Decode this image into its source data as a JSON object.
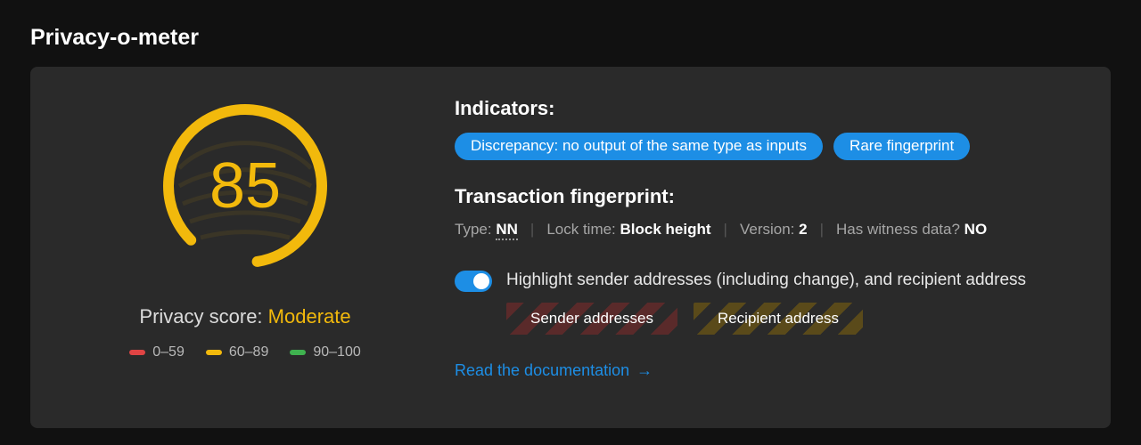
{
  "header": {
    "title": "Privacy-o-meter"
  },
  "score": {
    "value": "85",
    "label_prefix": "Privacy score: ",
    "rating": "Moderate"
  },
  "legend": {
    "low": "0–59",
    "mid": "60–89",
    "high": "90–100"
  },
  "indicators": {
    "heading": "Indicators:",
    "chips": [
      "Discrepancy: no output of the same type as inputs",
      "Rare fingerprint"
    ]
  },
  "fingerprint": {
    "heading": "Transaction fingerprint:",
    "type_label": "Type:",
    "type_value": "NN",
    "lock_label": "Lock time:",
    "lock_value": "Block height",
    "version_label": "Version:",
    "version_value": "2",
    "witness_label": "Has witness data?",
    "witness_value": "NO"
  },
  "highlight": {
    "text": "Highlight sender addresses (including change), and recipient address",
    "sender_label": "Sender addresses",
    "recipient_label": "Recipient address"
  },
  "doc_link": "Read the documentation",
  "colors": {
    "accent_yellow": "#f2b90c",
    "accent_blue": "#1d8ee5",
    "panel_bg": "#2a2a2a"
  }
}
